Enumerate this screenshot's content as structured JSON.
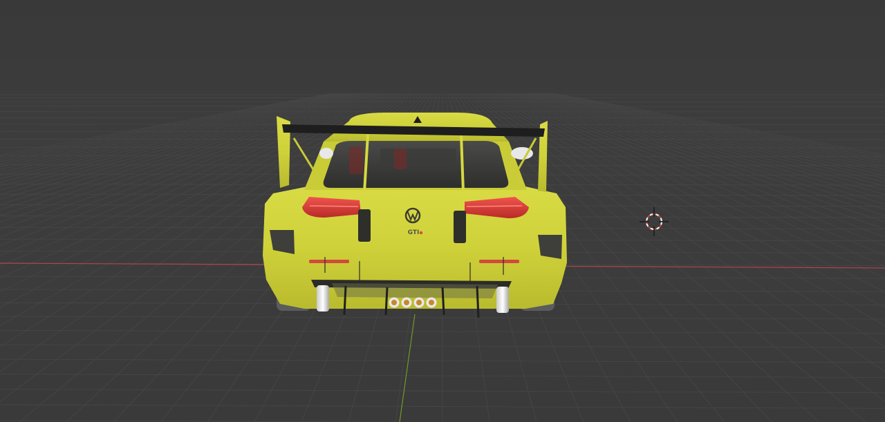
{
  "viewport": {
    "background_color": "#3c3c3c",
    "grid_color": "#474747",
    "x_axis_color": "#b2454b",
    "y_axis_color": "#6f9a2a"
  },
  "model": {
    "body_color": "#d2d43a",
    "badge_text": "GTI",
    "brand_icon": "vw-logo-icon"
  },
  "cursor": {
    "icon": "3d-cursor-icon",
    "colors": [
      "#c93c3c",
      "#f2f2f2"
    ]
  }
}
